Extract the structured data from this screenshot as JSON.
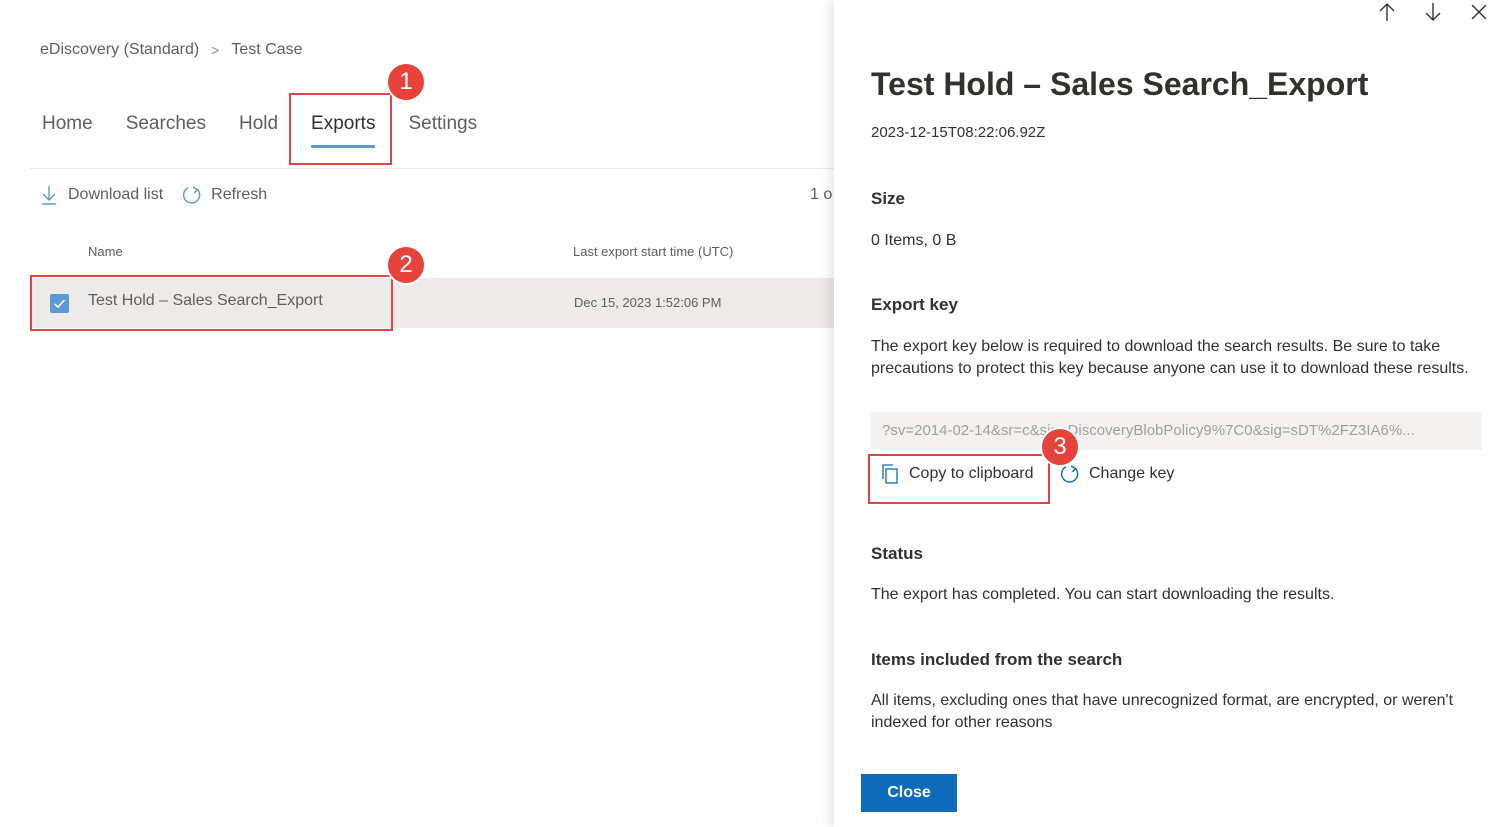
{
  "breadcrumb": {
    "parent": "eDiscovery (Standard)",
    "current": "Test Case",
    "separator": ">"
  },
  "tabs": [
    {
      "label": "Home"
    },
    {
      "label": "Searches"
    },
    {
      "label": "Hold"
    },
    {
      "label": "Exports",
      "active": true
    },
    {
      "label": "Settings"
    }
  ],
  "toolbar": {
    "download_label": "Download list",
    "refresh_label": "Refresh",
    "count_text": "1 o"
  },
  "table": {
    "columns": [
      "Name",
      "Last export start time (UTC)"
    ],
    "rows": [
      {
        "name": "Test Hold – Sales Search_Export",
        "time": "Dec 15, 2023 1:52:06 PM",
        "selected": true
      }
    ]
  },
  "annotations": [
    "1",
    "2",
    "3"
  ],
  "panel": {
    "title": "Test Hold – Sales Search_Export",
    "date": "2023-12-15T08:22:06.92Z",
    "size": {
      "heading": "Size",
      "value": "0 Items, 0 B"
    },
    "export_key": {
      "heading": "Export key",
      "description": "The export key below is required to download the search results. Be sure to take precautions to protect this key because anyone can use it to download these results.",
      "value": "?sv=2014-02-14&sr=c&si=eDiscoveryBlobPolicy9%7C0&sig=sDT%2FZ3IA6%...",
      "copy_label": "Copy to clipboard",
      "change_label": "Change key"
    },
    "status": {
      "heading": "Status",
      "text": "The export has completed. You can start downloading the results."
    },
    "items": {
      "heading": "Items included from the search",
      "text": "All items, excluding ones that have unrecognized format, are encrypted, or weren't indexed for other reasons"
    },
    "close_label": "Close"
  },
  "colors": {
    "accent": "#0f6cbd",
    "annotation": "#e8433b",
    "tab_underline": "#5b9bd5",
    "selected_row": "#edebe9"
  }
}
